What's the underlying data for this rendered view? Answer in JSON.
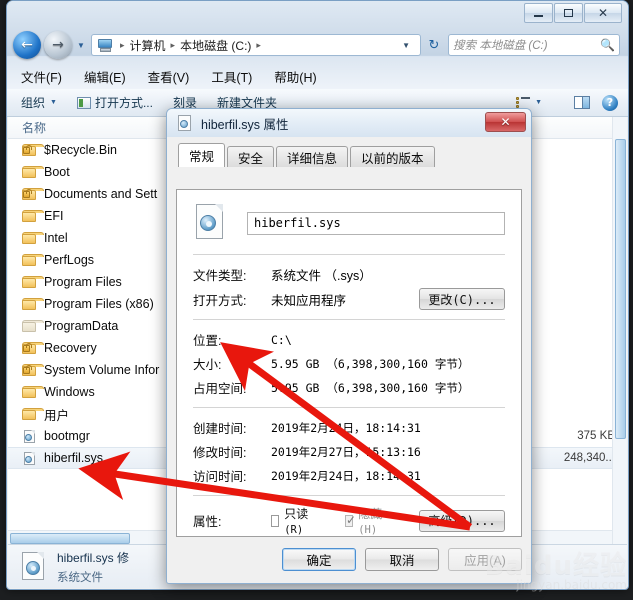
{
  "window": {
    "controls": {
      "minimize": "—",
      "maximize": "▣",
      "close": "✕"
    }
  },
  "address": {
    "crumbs": [
      "计算机",
      "本地磁盘 (C:)"
    ],
    "separator": "▸",
    "dropdown": "▼",
    "refresh_icon": "refresh-icon",
    "back_glyph": "←",
    "forward_glyph": "→",
    "history_glyph": "▼"
  },
  "search": {
    "placeholder": "搜索 本地磁盘 (C:)",
    "icon": "search-icon"
  },
  "menubar": {
    "items": [
      "文件(F)",
      "编辑(E)",
      "查看(V)",
      "工具(T)",
      "帮助(H)"
    ]
  },
  "toolbar": {
    "organize": "组织",
    "open_with": "打开方式...",
    "burn": "刻录",
    "new_folder": "新建文件夹",
    "caret": "▼",
    "view_icon": "list-view-icon",
    "pane_icon": "preview-pane-icon",
    "help_icon": "help-icon",
    "help_glyph": "?"
  },
  "filelist": {
    "column_header": "名称",
    "sort_arrow": "▲",
    "rows": [
      {
        "name": "$Recycle.Bin",
        "icon": "locked-folder-icon",
        "size": ""
      },
      {
        "name": "Boot",
        "icon": "folder-icon",
        "size": ""
      },
      {
        "name": "Documents and Sett",
        "icon": "locked-folder-icon",
        "size": ""
      },
      {
        "name": "EFI",
        "icon": "folder-icon",
        "size": ""
      },
      {
        "name": "Intel",
        "icon": "folder-icon",
        "size": ""
      },
      {
        "name": "PerfLogs",
        "icon": "folder-icon",
        "size": ""
      },
      {
        "name": "Program Files",
        "icon": "folder-icon",
        "size": ""
      },
      {
        "name": "Program Files (x86)",
        "icon": "folder-icon",
        "size": ""
      },
      {
        "name": "ProgramData",
        "icon": "folder-dim-icon",
        "size": ""
      },
      {
        "name": "Recovery",
        "icon": "locked-folder-icon",
        "size": ""
      },
      {
        "name": "System Volume Infor",
        "icon": "locked-folder-icon",
        "size": ""
      },
      {
        "name": "Windows",
        "icon": "folder-icon",
        "size": ""
      },
      {
        "name": "用户",
        "icon": "folder-icon",
        "size": ""
      },
      {
        "name": "bootmgr",
        "icon": "system-file-icon",
        "size": "375 KB"
      },
      {
        "name": "hiberfil.sys",
        "icon": "system-file-icon",
        "size": "248,340..."
      }
    ],
    "selected_index": 14
  },
  "statusbar": {
    "filename": "hiberfil.sys",
    "filename_suffix": "修",
    "filetype": "系统文件"
  },
  "dialog": {
    "title": "hiberfil.sys 属性",
    "close_glyph": "✕",
    "tabs": [
      "常规",
      "安全",
      "详细信息",
      "以前的版本"
    ],
    "active_tab": 0,
    "filename_value": "hiberfil.sys",
    "fields": [
      {
        "label": "文件类型:",
        "value": "系统文件 （.sys）",
        "cjk": true
      },
      {
        "label": "打开方式:",
        "value": "未知应用程序",
        "cjk": true,
        "button": "更改(C)..."
      },
      {
        "label": "位置:",
        "value": "C:\\"
      },
      {
        "label": "大小:",
        "value": "5.95 GB （6,398,300,160 字节）"
      },
      {
        "label": "占用空间:",
        "value": "5.95 GB （6,398,300,160 字节）"
      },
      {
        "label": "创建时间:",
        "value": "2019年2月24日，18:14:31"
      },
      {
        "label": "修改时间:",
        "value": "2019年2月27日，15:13:16"
      },
      {
        "label": "访问时间:",
        "value": "2019年2月24日，18:14:31"
      }
    ],
    "attributes": {
      "label": "属性:",
      "readonly": {
        "text": "只读",
        "hotkey": "(R)",
        "checked": false,
        "disabled": false
      },
      "hidden": {
        "text": "隐藏",
        "hotkey": "(H)",
        "checked": true,
        "disabled": true
      },
      "advanced_button": "高级(D)..."
    },
    "buttons": {
      "ok": "确定",
      "cancel": "取消",
      "apply": "应用(A)"
    }
  },
  "annotations": {
    "arrow_color": "#e8170d",
    "arrow_1_target": "占用空间 label",
    "arrow_2_target": "hiberfil.sys list row"
  },
  "watermark": {
    "line1": "Baidu经验",
    "line2": "jingyan.baidu.com"
  }
}
